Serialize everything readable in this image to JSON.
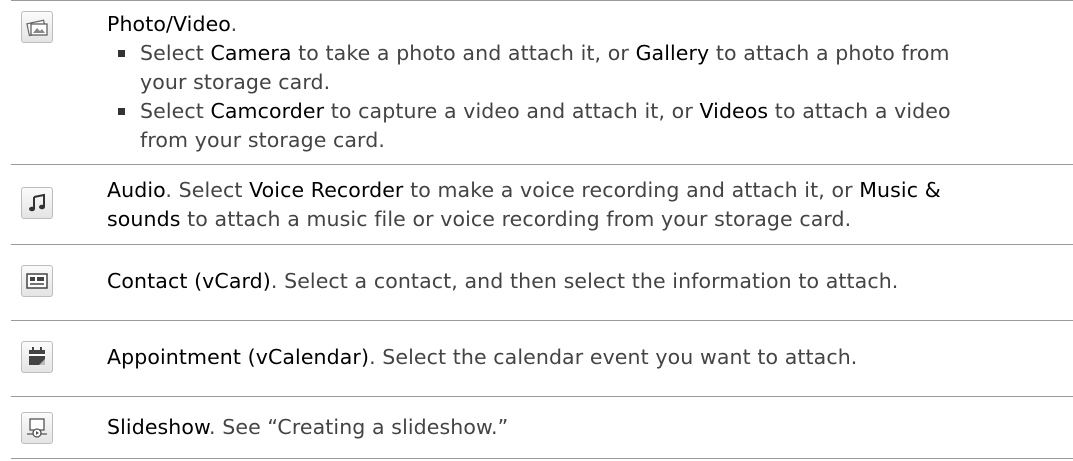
{
  "rows": [
    {
      "icon": "photo-video-icon",
      "title": "Photo/Video",
      "title_suffix": ".",
      "bullets": [
        {
          "parts": [
            {
              "t": "Select ",
              "em": false
            },
            {
              "t": "Camera",
              "em": true
            },
            {
              "t": " to take a photo and attach it, or ",
              "em": false
            },
            {
              "t": "Gallery",
              "em": true
            },
            {
              "t": " to attach a photo from",
              "em": false
            }
          ],
          "line2": "your storage card."
        },
        {
          "parts": [
            {
              "t": "Select ",
              "em": false
            },
            {
              "t": "Camcorder",
              "em": true
            },
            {
              "t": " to capture a video and attach it, or ",
              "em": false
            },
            {
              "t": "Videos",
              "em": true
            },
            {
              "t": " to attach a video",
              "em": false
            }
          ],
          "line2": "from your storage card."
        }
      ]
    },
    {
      "icon": "music-note-icon",
      "line1_parts": [
        {
          "t": "Audio",
          "em": true
        },
        {
          "t": ". Select ",
          "em": false
        },
        {
          "t": "Voice Recorder",
          "em": true
        },
        {
          "t": " to make a voice recording and attach it, or ",
          "em": false
        },
        {
          "t": "Music &",
          "em": true
        }
      ],
      "line2_parts": [
        {
          "t": "sounds",
          "em": true
        },
        {
          "t": " to attach a music file or voice recording from your storage card.",
          "em": false
        }
      ]
    },
    {
      "icon": "contact-card-icon",
      "line1_parts": [
        {
          "t": "Contact (vCard)",
          "em": true
        },
        {
          "t": ". Select a contact, and then select the information to attach.",
          "em": false
        }
      ]
    },
    {
      "icon": "calendar-icon",
      "line1_parts": [
        {
          "t": "Appointment (vCalendar)",
          "em": true
        },
        {
          "t": ". Select the calendar event you want to attach.",
          "em": false
        }
      ]
    },
    {
      "icon": "slideshow-icon",
      "line1_parts": [
        {
          "t": "Slideshow",
          "em": true
        },
        {
          "t": ". See “Creating a slideshow.”",
          "em": false
        }
      ]
    }
  ]
}
